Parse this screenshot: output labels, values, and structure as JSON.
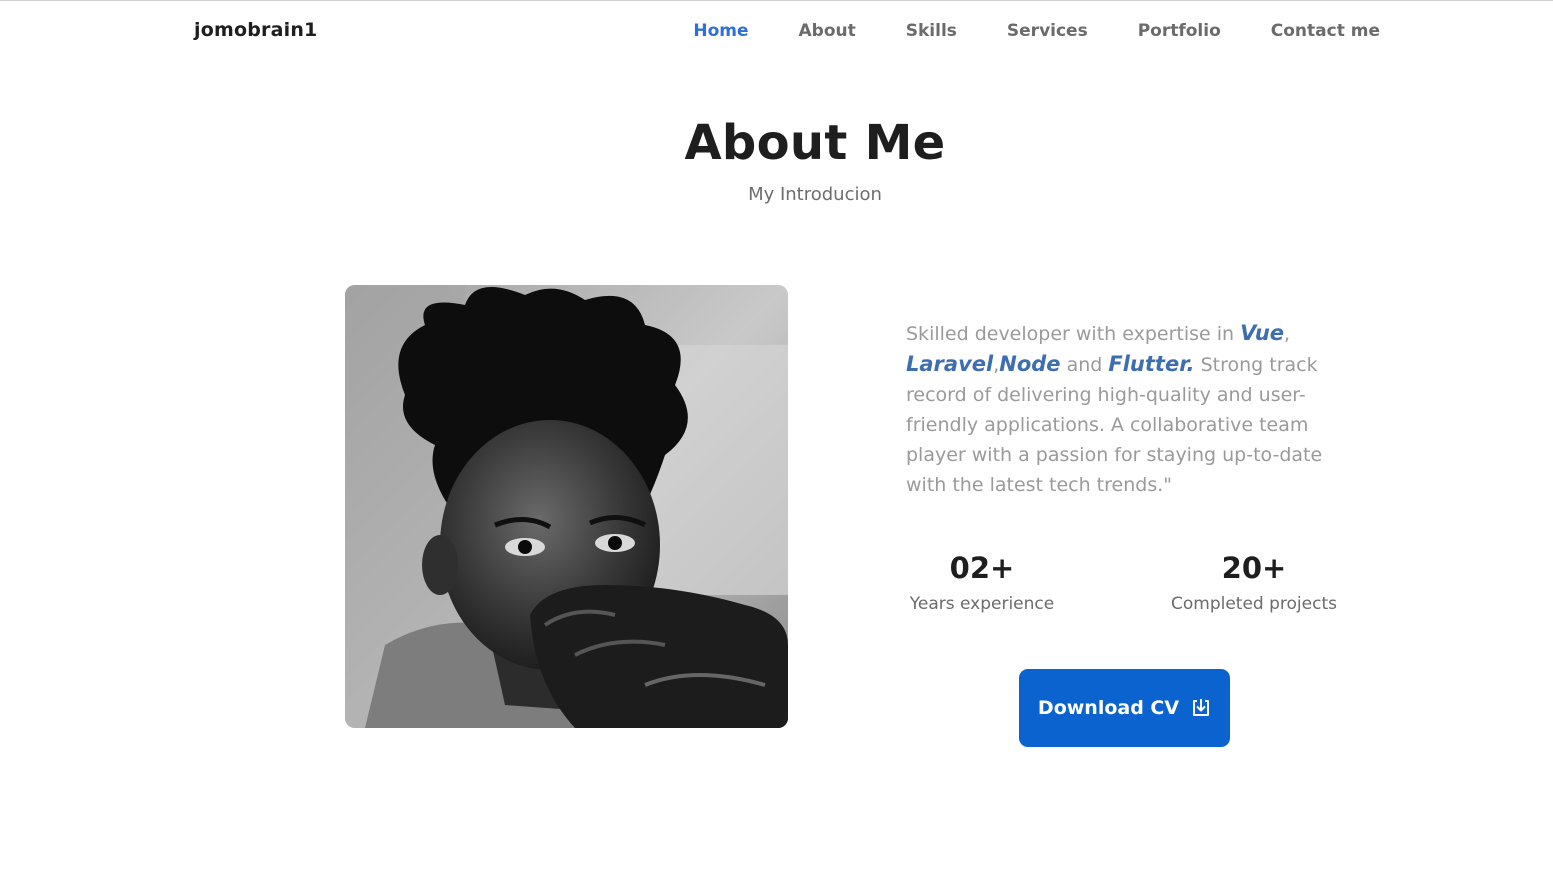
{
  "header": {
    "logo": "jomobrain1",
    "nav": [
      {
        "label": "Home",
        "active": true
      },
      {
        "label": "About",
        "active": false
      },
      {
        "label": "Skills",
        "active": false
      },
      {
        "label": "Services",
        "active": false
      },
      {
        "label": "Portfolio",
        "active": false
      },
      {
        "label": "Contact me",
        "active": false
      }
    ]
  },
  "section": {
    "title": "About Me",
    "subtitle": "My Introducion"
  },
  "about": {
    "text_start": "Skilled developer with expertise in ",
    "tech1": "Vue",
    "sep1": ",",
    "tech2": "Laravel",
    "sep2": ",",
    "tech3": "Node",
    "and": " and ",
    "tech4": "Flutter.",
    "text_end": " Strong track record of delivering high-quality and user-friendly applications. A collaborative team player with a passion for staying up-to-date with the latest tech trends.\""
  },
  "stats": [
    {
      "value": "02+",
      "label": "Years experience"
    },
    {
      "value": "20+",
      "label": "Completed projects"
    }
  ],
  "cta": {
    "label": "Download CV",
    "icon": "download-icon"
  },
  "colors": {
    "accent": "#0a63cf",
    "active_nav": "#2f6fd6",
    "tech_highlight": "#3d6eb0",
    "body_text": "#9a9a9a"
  }
}
